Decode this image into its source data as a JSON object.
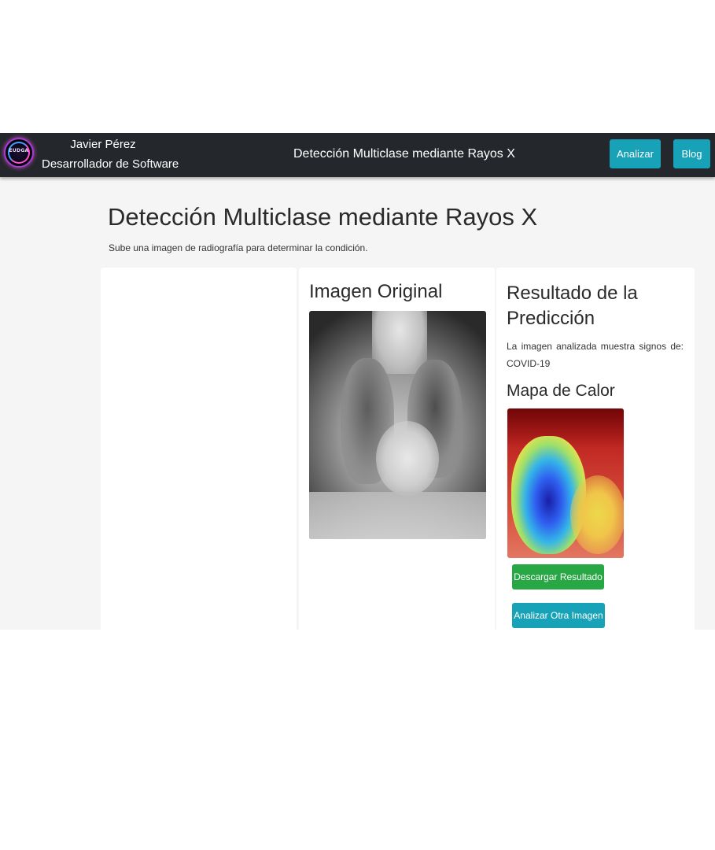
{
  "navbar": {
    "brand_name": "Javier Pérez",
    "brand_role": "Desarrollador de Software",
    "logo_text": "EUDGA",
    "title": "Detección Multiclase mediante Rayos X",
    "buttons": {
      "analizar": "Analizar",
      "blog": "Blog"
    }
  },
  "main": {
    "title": "Detección Multiclase mediante Rayos X",
    "subtitle": "Sube una imagen de radiografía para determinar la condición."
  },
  "original": {
    "heading": "Imagen Original"
  },
  "result": {
    "heading": "Resultado de la Predicción",
    "text": "La imagen analizada muestra signos de: COVID-19",
    "heatmap_heading": "Mapa de Calor",
    "download_label": "Descargar Resultado",
    "again_label": "Analizar Otra Imagen"
  },
  "colors": {
    "navbar": "#24272b",
    "accent_teal": "#17a2b8",
    "success_green": "#28a745",
    "page_bg": "#f5f5f5"
  }
}
